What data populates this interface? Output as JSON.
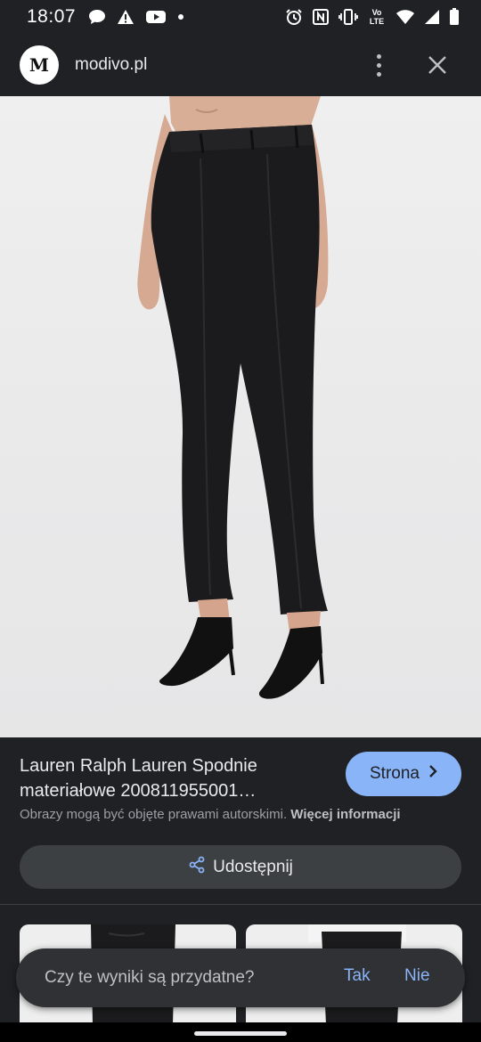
{
  "status_bar": {
    "time": "18:07",
    "left_icons": [
      "chat-bubble-icon",
      "warning-icon",
      "youtube-icon",
      "dot-icon"
    ],
    "right_icons": [
      "alarm-icon",
      "nfc-icon",
      "vibrate-icon",
      "volte-icon",
      "wifi-icon",
      "signal-icon",
      "battery-icon"
    ],
    "volte_label": "Vo LTE"
  },
  "header": {
    "logo_letter": "M",
    "site_name": "modivo.pl",
    "menu_icon": "more-vert-icon",
    "close_icon": "close-icon"
  },
  "product": {
    "title": "Lauren Ralph Lauren Spodnie materiałowe 200811955001…",
    "visit_label": "Strona",
    "copyright_text": "Obrazy mogą być objęte prawami autorskimi.",
    "more_info_label": "Więcej informacji",
    "share_label": "Udostępnij"
  },
  "feedback": {
    "question": "Czy te wyniki są przydatne?",
    "yes": "Tak",
    "no": "Nie"
  },
  "colors": {
    "background": "#202124",
    "accent": "#8ab4f8",
    "share_button": "#3c4043",
    "toast": "#303134"
  }
}
